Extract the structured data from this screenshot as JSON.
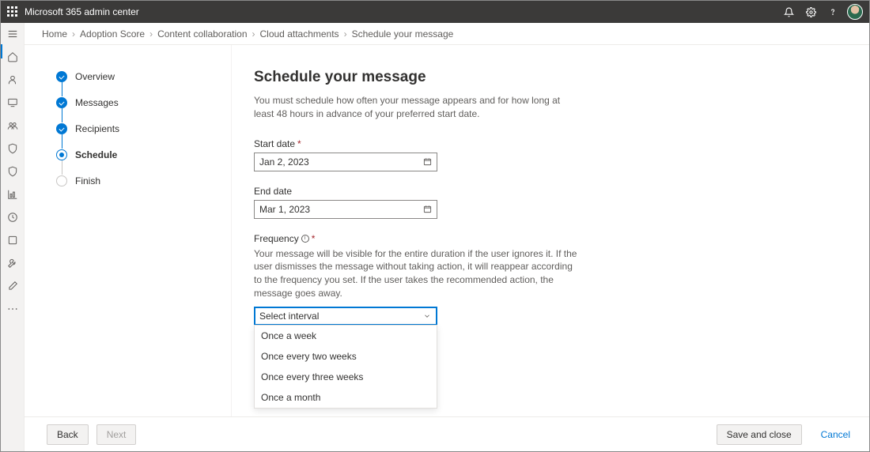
{
  "header": {
    "title": "Microsoft 365 admin center"
  },
  "breadcrumbs": [
    "Home",
    "Adoption Score",
    "Content collaboration",
    "Cloud attachments",
    "Schedule your message"
  ],
  "steps": [
    {
      "label": "Overview",
      "state": "done"
    },
    {
      "label": "Messages",
      "state": "done"
    },
    {
      "label": "Recipients",
      "state": "done"
    },
    {
      "label": "Schedule",
      "state": "current"
    },
    {
      "label": "Finish",
      "state": "future"
    }
  ],
  "form": {
    "heading": "Schedule your message",
    "intro": "You must schedule how often your message appears and for how long at least 48 hours in advance of your preferred start date.",
    "start_date": {
      "label": "Start date",
      "required": true,
      "value": "Jan 2, 2023"
    },
    "end_date": {
      "label": "End date",
      "required": false,
      "value": "Mar 1, 2023"
    },
    "frequency": {
      "label": "Frequency",
      "required": true,
      "help": "Your message will be visible for the entire duration if the user ignores it. If the user dismisses the message without taking action, it will reappear according to the frequency you set. If the user takes the recommended action, the message goes away.",
      "placeholder": "Select interval",
      "options": [
        "Once a week",
        "Once every two weeks",
        "Once every three weeks",
        "Once a month"
      ]
    }
  },
  "footer": {
    "back": "Back",
    "next": "Next",
    "save": "Save and close",
    "cancel": "Cancel"
  }
}
